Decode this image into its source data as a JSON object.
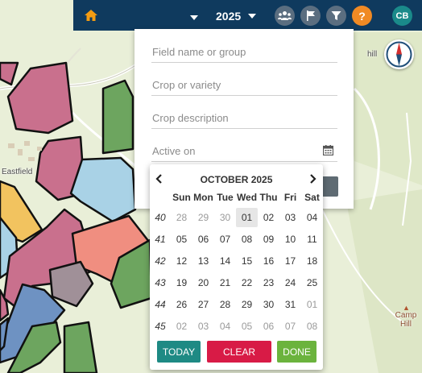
{
  "map": {
    "labels": [
      "Eastfield",
      "hill",
      "Camp Hill"
    ]
  },
  "topbar": {
    "home_icon": "home-icon",
    "year": "2025",
    "icons": [
      "users-icon",
      "flag-icon",
      "filter-icon"
    ],
    "help_label": "?",
    "avatar_initials": "CB",
    "colors": {
      "bar": "#0f3a5e",
      "home": "#f39c12",
      "help": "#f08a24",
      "avatar": "#1a8a8a"
    }
  },
  "filter_panel": {
    "field_placeholder": "Field name or group",
    "crop_placeholder": "Crop or variety",
    "desc_placeholder": "Crop description",
    "active_placeholder": "Active on",
    "calendar_icon": "calendar-icon"
  },
  "datepicker": {
    "month_label": "OCTOBER 2025",
    "weekdays": [
      "Sun",
      "Mon",
      "Tue",
      "Wed",
      "Thu",
      "Fri",
      "Sat"
    ],
    "weeks": [
      {
        "num": "40",
        "days": [
          {
            "d": "28",
            "muted": true
          },
          {
            "d": "29",
            "muted": true
          },
          {
            "d": "30",
            "muted": true
          },
          {
            "d": "01",
            "today": true
          },
          {
            "d": "02"
          },
          {
            "d": "03"
          },
          {
            "d": "04"
          }
        ]
      },
      {
        "num": "41",
        "days": [
          {
            "d": "05"
          },
          {
            "d": "06"
          },
          {
            "d": "07"
          },
          {
            "d": "08"
          },
          {
            "d": "09"
          },
          {
            "d": "10"
          },
          {
            "d": "11"
          }
        ]
      },
      {
        "num": "42",
        "days": [
          {
            "d": "12"
          },
          {
            "d": "13"
          },
          {
            "d": "14"
          },
          {
            "d": "15"
          },
          {
            "d": "16"
          },
          {
            "d": "17"
          },
          {
            "d": "18"
          }
        ]
      },
      {
        "num": "43",
        "days": [
          {
            "d": "19"
          },
          {
            "d": "20"
          },
          {
            "d": "21"
          },
          {
            "d": "22"
          },
          {
            "d": "23"
          },
          {
            "d": "24"
          },
          {
            "d": "25"
          }
        ]
      },
      {
        "num": "44",
        "days": [
          {
            "d": "26"
          },
          {
            "d": "27"
          },
          {
            "d": "28"
          },
          {
            "d": "29"
          },
          {
            "d": "30"
          },
          {
            "d": "31"
          },
          {
            "d": "01",
            "muted": true
          }
        ]
      },
      {
        "num": "45",
        "days": [
          {
            "d": "02",
            "muted": true
          },
          {
            "d": "03",
            "muted": true
          },
          {
            "d": "04",
            "muted": true
          },
          {
            "d": "05",
            "muted": true
          },
          {
            "d": "06",
            "muted": true
          },
          {
            "d": "07",
            "muted": true
          },
          {
            "d": "08",
            "muted": true
          }
        ]
      }
    ],
    "today_label": "TODAY",
    "clear_label": "CLEAR",
    "done_label": "DONE",
    "colors": {
      "today": "#1e8a84",
      "clear": "#d81b46",
      "done": "#6bb33d"
    }
  }
}
